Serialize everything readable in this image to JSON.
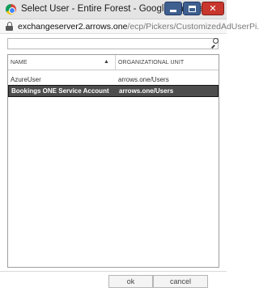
{
  "window": {
    "title": "Select User - Entire Forest - Google Chrome",
    "controls": [
      "minimize-icon",
      "maximize-icon",
      "close-icon"
    ]
  },
  "address": {
    "host": "exchangeserver2.arrows.one",
    "path": "/ecp/Pickers/CustomizedAdUserPi..."
  },
  "search": {
    "value": "",
    "placeholder": ""
  },
  "grid": {
    "columns": [
      {
        "label": "NAME",
        "sort": "ascending"
      },
      {
        "label": "ORGANIZATIONAL UNIT"
      }
    ],
    "rows": [
      {
        "name": "AzureUser",
        "ou": "arrows.one/Users",
        "selected": false
      },
      {
        "name": "Bookings ONE Service Account",
        "ou": "arrows.one/Users",
        "selected": true
      }
    ]
  },
  "buttons": {
    "ok": "ok",
    "cancel": "cancel"
  },
  "colors": {
    "selected_row": "#4d4d4d",
    "close_button": "#c8372d",
    "window_buttons": "#3f5f8f"
  }
}
